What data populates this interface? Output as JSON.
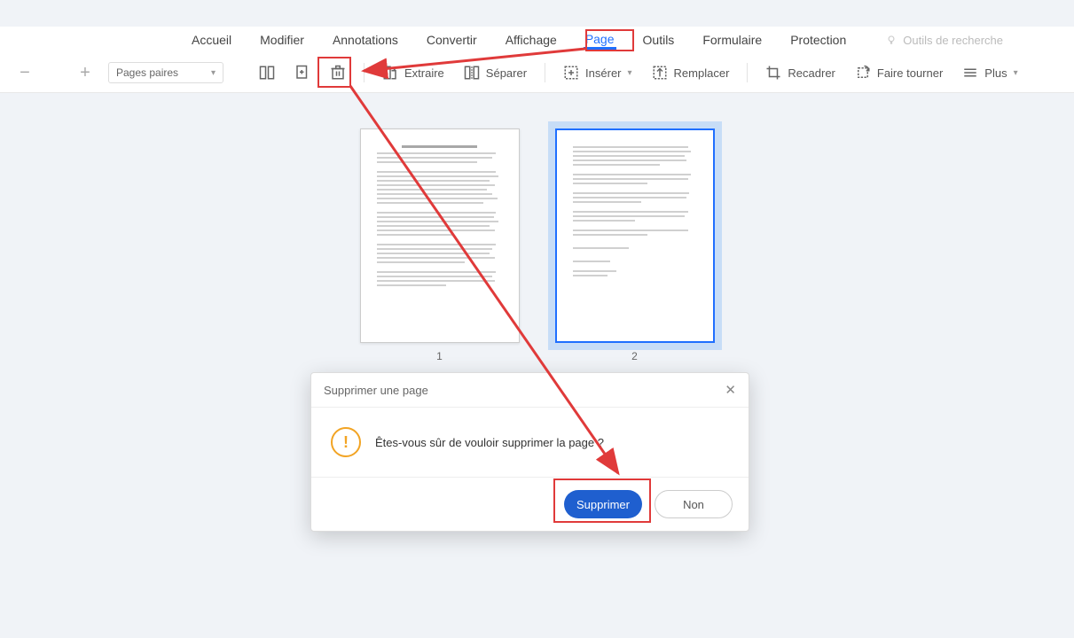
{
  "menubar": {
    "items": [
      {
        "label": "Accueil"
      },
      {
        "label": "Modifier"
      },
      {
        "label": "Annotations"
      },
      {
        "label": "Convertir"
      },
      {
        "label": "Affichage"
      },
      {
        "label": "Page",
        "active": true
      },
      {
        "label": "Outils"
      },
      {
        "label": "Formulaire"
      },
      {
        "label": "Protection"
      }
    ],
    "search_tools_label": "Outils de recherche"
  },
  "toolbar": {
    "zoom_out": "−",
    "zoom_in": "+",
    "page_filter": "Pages paires",
    "extract_label": "Extraire",
    "split_label": "Séparer",
    "insert_label": "Insérer",
    "replace_label": "Remplacer",
    "crop_label": "Recadrer",
    "rotate_label": "Faire tourner",
    "more_label": "Plus"
  },
  "pages": [
    {
      "number": "1",
      "selected": false
    },
    {
      "number": "2",
      "selected": true
    }
  ],
  "dialog": {
    "title": "Supprimer une page",
    "message": "Êtes-vous sûr de vouloir supprimer la page ?",
    "confirm_label": "Supprimer",
    "cancel_label": "Non"
  },
  "colors": {
    "accent": "#1f6fff",
    "highlight": "#e03a3a",
    "warning": "#f2a424"
  }
}
